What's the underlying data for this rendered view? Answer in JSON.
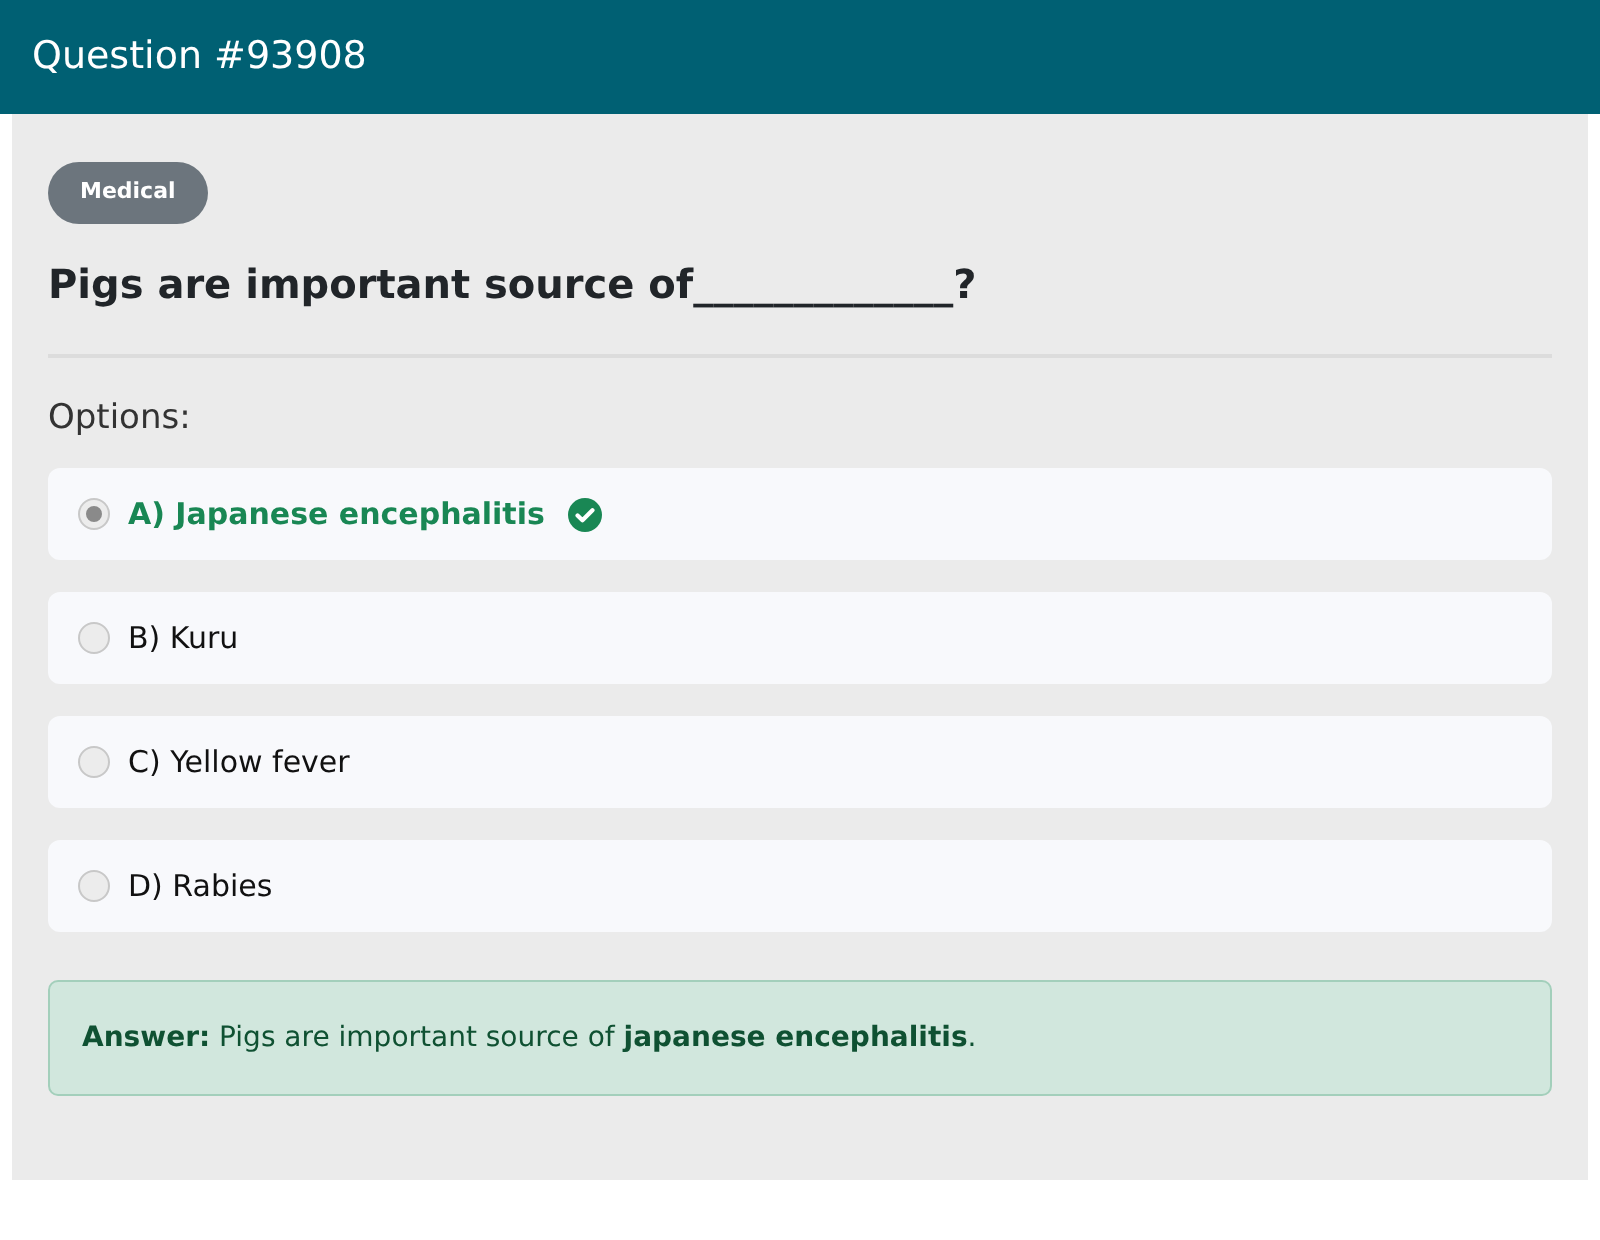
{
  "header": {
    "title": "Question #93908"
  },
  "category": "Medical",
  "question": "Pigs are important source of_____________?",
  "options_label": "Options:",
  "options": [
    {
      "label": "A) Japanese encephalitis",
      "selected": true,
      "correct": true
    },
    {
      "label": "B) Kuru",
      "selected": false,
      "correct": false
    },
    {
      "label": "C) Yellow fever",
      "selected": false,
      "correct": false
    },
    {
      "label": "D) Rabies",
      "selected": false,
      "correct": false
    }
  ],
  "answer": "**Answer:** Pigs are important source of **japanese encephalitis**."
}
